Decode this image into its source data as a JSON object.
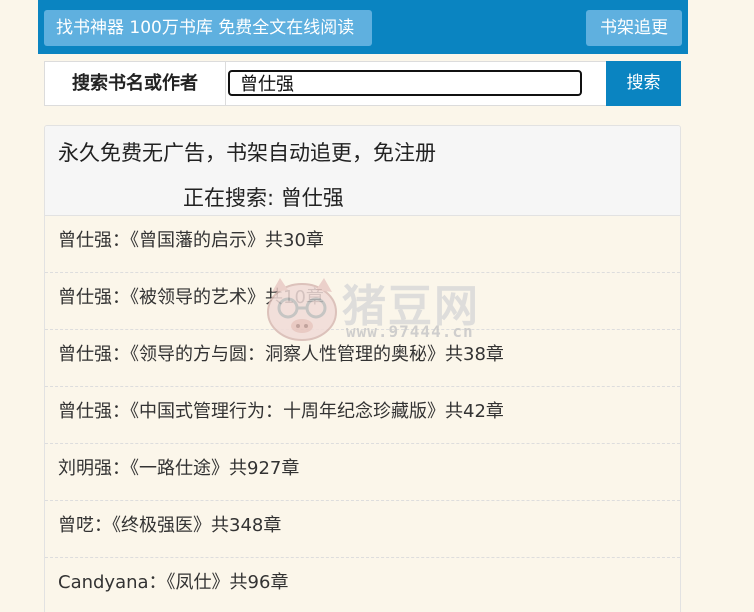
{
  "header": {
    "site_button_label": "找书神器 100万书库 免费全文在线阅读",
    "bookshelf_button_label": "书架追更"
  },
  "search": {
    "label": "搜索书名或作者",
    "value": "曾仕强",
    "button_label": "搜索"
  },
  "panel": {
    "title": "永久免费无广告，书架自动追更，免注册",
    "subtitle": "正在搜索: 曾仕强"
  },
  "results": [
    "曾仕强：《曾国藩的启示》共30章",
    "曾仕强：《被领导的艺术》共10章",
    "曾仕强：《领导的方与圆：洞察人性管理的奥秘》共38章",
    "曾仕强：《中国式管理行为：十周年纪念珍藏版》共42章",
    "刘明强：《一路仕途》共927章",
    "曾呓：《终极强医》共348章",
    "Candyana：《凤仕》共96章"
  ],
  "watermark": {
    "text": "猪豆网",
    "url": "www.97444.cn"
  },
  "colors": {
    "primary": "#0a84c1",
    "button_light": "#5fb0df",
    "background": "#fbf6ea"
  }
}
